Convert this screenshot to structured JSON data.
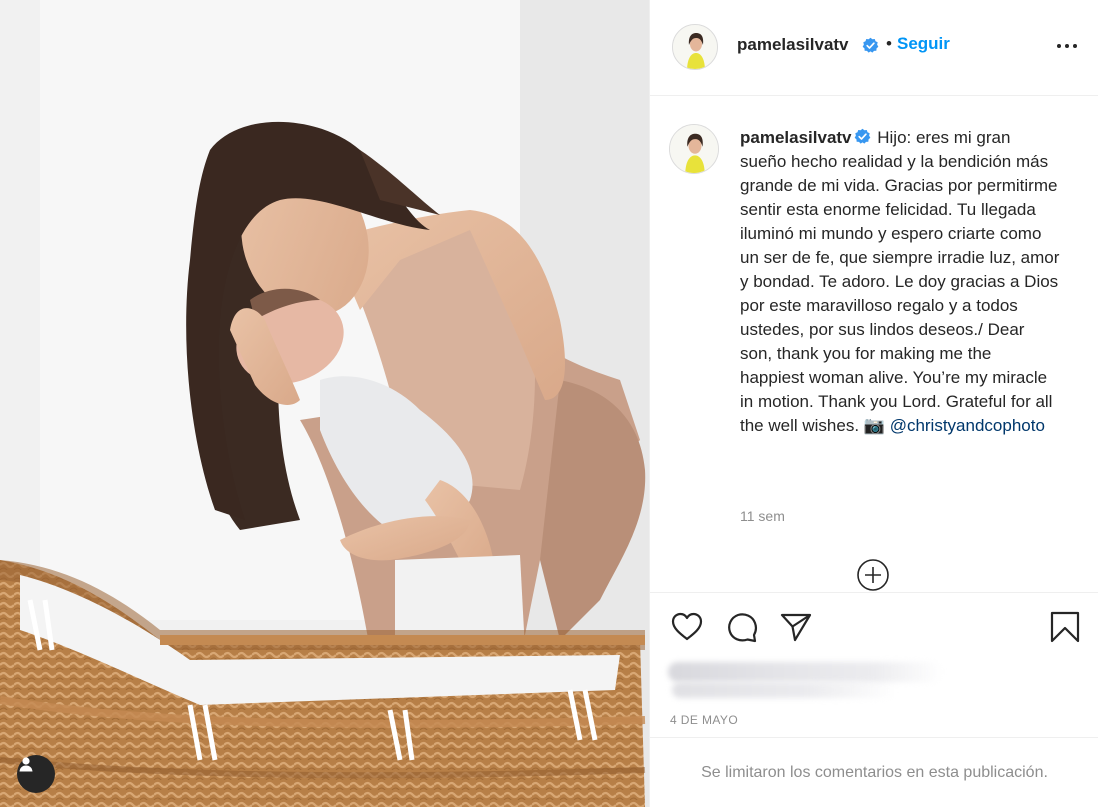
{
  "post": {
    "username": "pamelasilvatv",
    "follow_label": "Seguir",
    "separator": "•",
    "caption_text": "Hijo: eres mi gran sueño hecho realidad y la bendición más grande de mi vida. Gracias por permitirme sentir esta enorme felicidad. Tu llegada iluminó mi mundo y espero criarte como un ser de fe, que siempre irradie luz, amor y bondad. Te adoro. Le doy gracias a Dios por este maravilloso regalo y a todos ustedes, por sus lindos deseos./ Dear son, thank you for making me the happiest woman alive. You’re my miracle in motion. Thank you Lord. Grateful for all the well wishes. 📷",
    "mention": "@christyandcophoto",
    "time_ago": "11 sem",
    "date": "4 DE MAYO",
    "comments_limited": "Se limitaron los comentarios en esta publicación."
  },
  "icons": {
    "verified": "verified-badge-icon",
    "like": "heart-icon",
    "comment": "comment-bubble-icon",
    "share": "paper-plane-icon",
    "save": "bookmark-icon",
    "more": "more-options-icon",
    "load_more": "plus-circle-icon",
    "tagged_users": "user-tag-icon"
  },
  "colors": {
    "accent": "#0095f6",
    "verified": "#3897f0",
    "mention": "#00376b",
    "muted": "#8e8e8e",
    "text": "#262626"
  }
}
